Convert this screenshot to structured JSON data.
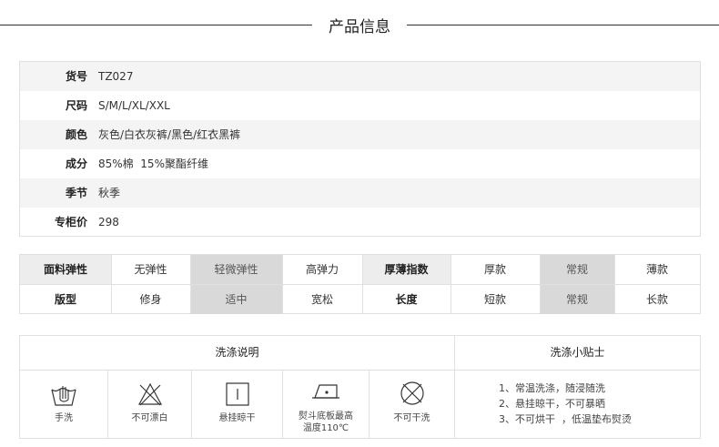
{
  "header": {
    "title": "产品信息"
  },
  "info": [
    {
      "label": "货号",
      "value": "TZ027"
    },
    {
      "label": "尺码",
      "value": "S/M/L/XL/XXL"
    },
    {
      "label": "颜色",
      "value": "灰色/白衣灰裤/黑色/红衣黑裤"
    },
    {
      "label": "成分",
      "value": "85%棉  15%聚酯纤维"
    },
    {
      "label": "季节",
      "value": "秋季"
    },
    {
      "label": "专柜价",
      "value": "298"
    }
  ],
  "attributes": {
    "row1": [
      "面料弹性",
      "无弹性",
      "轻微弹性",
      "高弹力",
      "厚薄指数",
      "厚款",
      "常规",
      "薄款"
    ],
    "row2": [
      "版型",
      "修身",
      "适中",
      "宽松",
      "长度",
      "短款",
      "常规",
      "长款"
    ]
  },
  "wash": {
    "instructions_title": "洗涤说明",
    "tips_title": "洗涤小贴士",
    "icons": [
      {
        "icon": "hand-wash-icon",
        "label": "手洗"
      },
      {
        "icon": "no-bleach-icon",
        "label": "不可漂白"
      },
      {
        "icon": "hang-dry-icon",
        "label": "悬挂晾干"
      },
      {
        "icon": "iron-icon",
        "label_line1": "熨斗底板最高",
        "label_line2": "温度110℃"
      },
      {
        "icon": "no-dry-clean-icon",
        "label": "不可干洗"
      }
    ],
    "tips": [
      "1、常温洗涤，随浸随洗",
      "2、悬挂晾干，不可暴晒",
      "3、不可烘干  ，低温垫布熨烫"
    ]
  }
}
